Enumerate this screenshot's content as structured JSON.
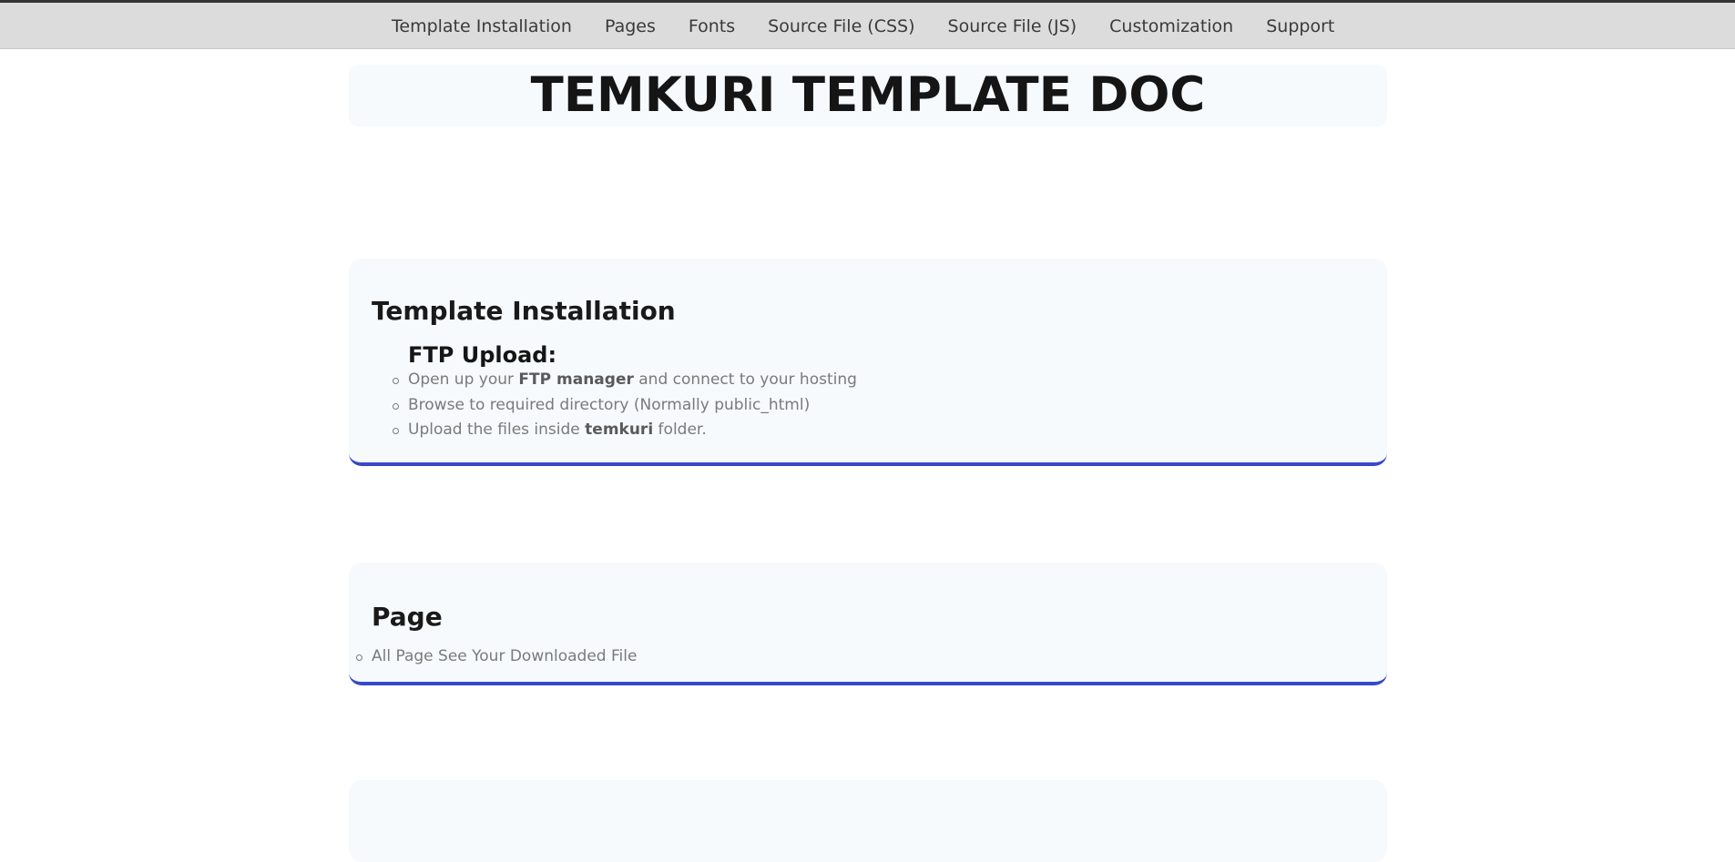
{
  "nav": {
    "items": [
      {
        "label": "Template Installation"
      },
      {
        "label": "Pages"
      },
      {
        "label": "Fonts"
      },
      {
        "label": "Source File (CSS)"
      },
      {
        "label": "Source File (JS)"
      },
      {
        "label": "Customization"
      },
      {
        "label": "Support"
      }
    ]
  },
  "header": {
    "title": "TEMKURI TEMPLATE DOC"
  },
  "installation": {
    "title": "Template Installation",
    "subtitle": "FTP Upload:",
    "steps": [
      {
        "pre": "Open up your ",
        "bold": "FTP manager",
        "post": " and connect to your hosting"
      },
      {
        "pre": "Browse to required directory (Normally public_html)",
        "bold": "",
        "post": ""
      },
      {
        "pre": "Upload the files inside ",
        "bold": "temkuri",
        "post": " folder."
      }
    ]
  },
  "page_section": {
    "title": "Page",
    "items": [
      {
        "text": "All Page See Your Downloaded File"
      }
    ]
  },
  "colors": {
    "accent": "#3748c8",
    "card_bg": "#f6fafd",
    "nav_bg": "#dcdcdc"
  }
}
